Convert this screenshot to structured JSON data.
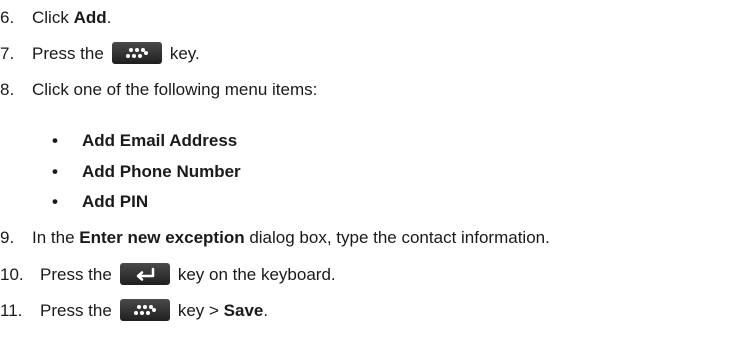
{
  "steps": {
    "s6": {
      "num": "6.",
      "pre": "Click ",
      "bold": "Add",
      "post": "."
    },
    "s7": {
      "num": "7.",
      "pre": "Press the",
      "post": "key."
    },
    "s8": {
      "num": "8.",
      "text": "Click one of the following menu items:"
    },
    "bullets": [
      "Add Email Address",
      "Add Phone Number",
      "Add PIN"
    ],
    "bullet_symbol": "•",
    "s9": {
      "num": "9.",
      "pre": "In the ",
      "bold": "Enter new exception",
      "post": " dialog box, type the contact information."
    },
    "s10": {
      "num": "10.",
      "pre": "Press the",
      "post": "key on the keyboard."
    },
    "s11": {
      "num": "11.",
      "pre": "Press the",
      "mid": "key > ",
      "bold": "Save",
      "post": "."
    }
  },
  "icons": {
    "menu_key": "blackberry-menu-key-icon",
    "enter_key": "enter-key-icon"
  }
}
